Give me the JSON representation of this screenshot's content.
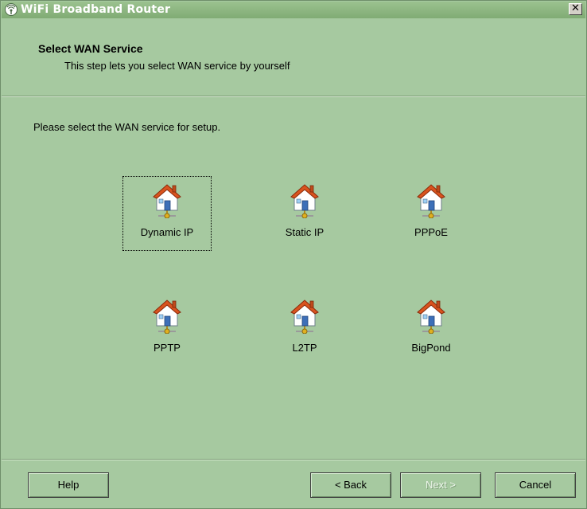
{
  "window": {
    "title": "WiFi Broadband Router",
    "close_glyph": "✕"
  },
  "header": {
    "title": "Select WAN Service",
    "subtitle": "This step lets you select WAN service by yourself"
  },
  "instruction": "Please select the WAN service for setup.",
  "options": [
    {
      "label": "Dynamic IP",
      "icon": "house-network-icon",
      "focused": true
    },
    {
      "label": "Static IP",
      "icon": "house-network-icon",
      "focused": false
    },
    {
      "label": "PPPoE",
      "icon": "house-network-icon",
      "focused": false
    },
    {
      "label": "PPTP",
      "icon": "house-network-icon",
      "focused": false
    },
    {
      "label": "L2TP",
      "icon": "house-network-icon",
      "focused": false
    },
    {
      "label": "BigPond",
      "icon": "house-network-icon",
      "focused": false
    }
  ],
  "buttons": {
    "help": "Help",
    "back": "< Back",
    "next": "Next >",
    "cancel": "Cancel",
    "next_enabled": false
  },
  "colors": {
    "background": "#a6c9a0",
    "titlebar": "#80ab74",
    "house_roof": "#d9531e",
    "house_wall": "#ffffff"
  }
}
